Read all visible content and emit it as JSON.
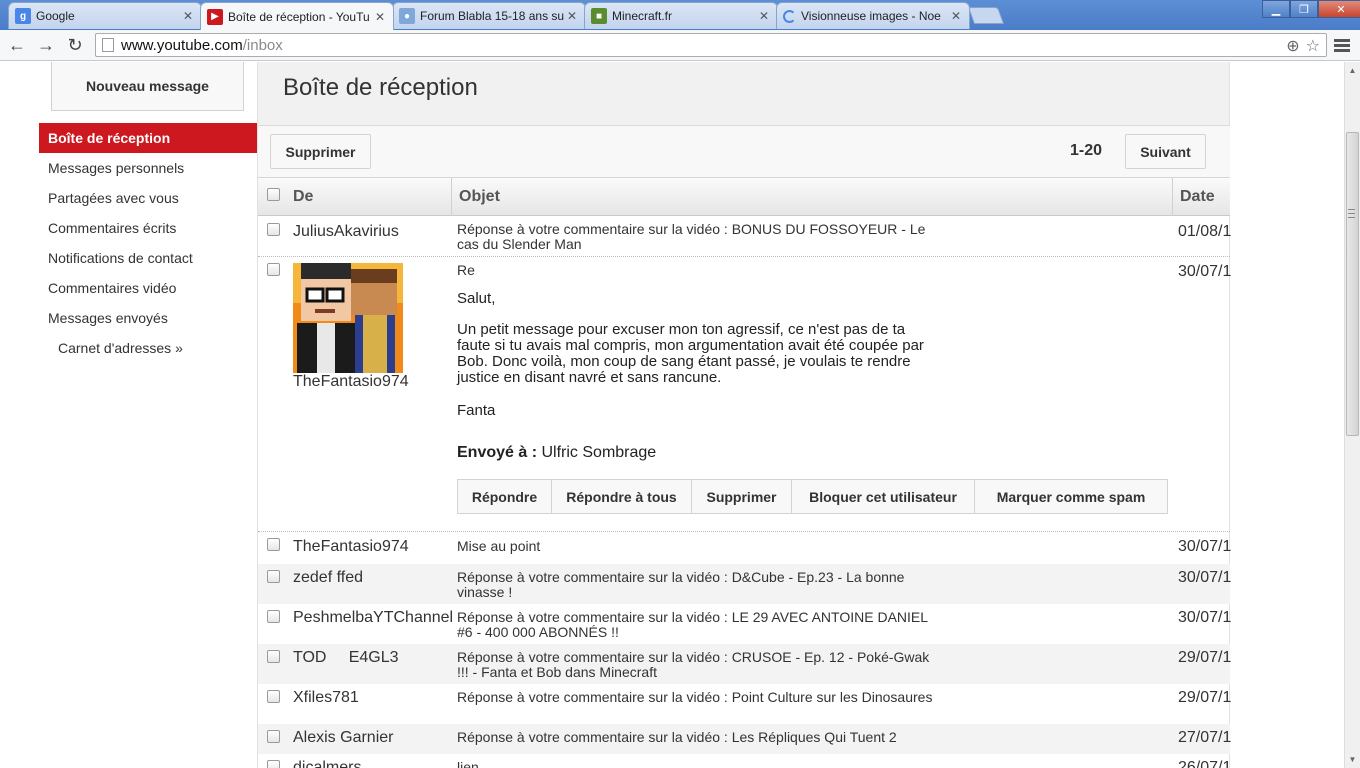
{
  "browser": {
    "tabs": [
      {
        "title": "Google",
        "icon": "google-favicon",
        "active": false
      },
      {
        "title": "Boîte de réception - YouTu",
        "icon": "youtube-favicon",
        "active": true
      },
      {
        "title": "Forum Blabla 15-18 ans su",
        "icon": "forum-favicon",
        "active": false
      },
      {
        "title": "Minecraft.fr",
        "icon": "minecraft-favicon",
        "active": false
      },
      {
        "title": "Visionneuse images - Noe",
        "icon": "loading-spinner-icon",
        "active": false
      }
    ],
    "url_host": "www.youtube.com",
    "url_path": "/inbox"
  },
  "sidebar": {
    "new_message": "Nouveau message",
    "items": [
      {
        "label": "Boîte de réception",
        "active": true
      },
      {
        "label": "Messages personnels"
      },
      {
        "label": "Partagées avec vous"
      },
      {
        "label": "Commentaires écrits"
      },
      {
        "label": "Notifications de contact"
      },
      {
        "label": "Commentaires vidéo"
      },
      {
        "label": "Messages envoyés"
      },
      {
        "label": "Carnet d'adresses »"
      }
    ]
  },
  "main": {
    "title": "Boîte de réception",
    "delete_label": "Supprimer",
    "pager": "1-20",
    "next_label": "Suivant",
    "columns": {
      "from": "De",
      "subject": "Objet",
      "date": "Date"
    }
  },
  "messages": [
    {
      "from": "JuliusAkavirius",
      "subject": "Réponse à votre commentaire sur la vidéo : BONUS DU FOSSOYEUR - Le cas du Slender Man",
      "date": "01/08/1"
    },
    {
      "from": "TheFantasio974",
      "subject": "Re",
      "date": "30/07/1",
      "body": {
        "greeting": "Salut,",
        "paragraph": "Un petit message pour excuser mon ton agressif, ce n'est pas de ta faute si tu avais mal compris, mon argumentation avait été coupée par Bob. Donc voilà, mon coup de sang étant passé, je voulais te rendre justice en disant navré et sans rancune.",
        "signature": "Fanta",
        "sent_to_label": "Envoyé à :",
        "sent_to": "Ulfric Sombrage"
      },
      "actions": [
        "Répondre",
        "Répondre à tous",
        "Supprimer",
        "Bloquer cet utilisateur",
        "Marquer comme spam"
      ]
    },
    {
      "from": "TheFantasio974",
      "subject": "Mise au point",
      "date": "30/07/1"
    },
    {
      "from": "zedef ffed",
      "subject": "Réponse à votre commentaire sur la vidéo : D&Cube - Ep.23 - La bonne vinasse !",
      "date": "30/07/1"
    },
    {
      "from": "PeshmelbaYTChannel",
      "subject": "Réponse à votre commentaire sur la vidéo : LE 29 AVEC ANTOINE DANIEL #6 - 400 000 ABONNÉS !!",
      "date": "30/07/1"
    },
    {
      "from": "TOD     E4GL3",
      "subject": "Réponse à votre commentaire sur la vidéo : CRUSOE - Ep. 12 - Poké-Gwak !!! - Fanta et Bob dans Minecraft",
      "date": "29/07/1"
    },
    {
      "from": "Xfiles781",
      "subject": "Réponse à votre commentaire sur la vidéo : Point Culture sur les Dinosaures",
      "date": "29/07/1"
    },
    {
      "from": "Alexis Garnier",
      "subject": "Réponse à votre commentaire sur la vidéo : Les Répliques Qui Tuent 2",
      "date": "27/07/1"
    },
    {
      "from": "dicalmers",
      "subject": "lien",
      "date": "26/07/1"
    }
  ],
  "colors": {
    "accent": "#cc181e",
    "header_bg": "#f1f1f1",
    "alt_row": "#f3f3f3"
  }
}
